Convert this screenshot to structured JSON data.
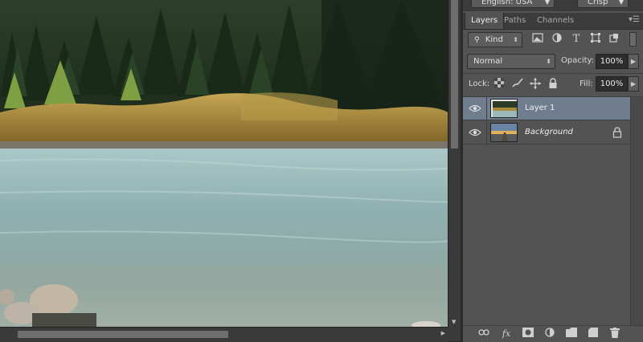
{
  "top": {
    "language_label": "English: USA",
    "sharpness_label": "Crisp"
  },
  "panel": {
    "tabs": [
      {
        "label": "Layers",
        "active": true
      },
      {
        "label": "Paths",
        "active": false
      },
      {
        "label": "Channels",
        "active": false
      }
    ],
    "menu_icon": "panel-menu-icon",
    "filter": {
      "kind_label": "Kind",
      "filter_icons": [
        "image-filter-icon",
        "adjustment-filter-icon",
        "type-filter-icon",
        "shape-filter-icon",
        "smart-object-filter-icon"
      ],
      "type_glyph": "T"
    },
    "blend_mode": "Normal",
    "opacity_label": "Opacity:",
    "opacity_value": "100%",
    "lock_label": "Lock:",
    "fill_label": "Fill:",
    "fill_value": "100%",
    "lock_icons": [
      "lock-transparent-icon",
      "lock-image-icon",
      "lock-position-icon",
      "lock-all-icon"
    ],
    "layers": [
      {
        "name": "Layer 1",
        "selected": true,
        "visible": true,
        "locked": false
      },
      {
        "name": "Background",
        "selected": false,
        "visible": true,
        "locked": true
      }
    ],
    "bottom_icons": [
      "link-layers-icon",
      "fx-icon",
      "add-mask-icon",
      "adjustment-layer-icon",
      "new-group-icon",
      "new-layer-icon",
      "delete-layer-icon"
    ],
    "fx_glyph": "fx"
  },
  "colors": {
    "panel_bg": "#535353",
    "selected_layer": "#6f7d8f",
    "scrollbar": "#3a3a3a",
    "water": "#93b5b6",
    "forest": "#223522",
    "shrubs": "#a8882e"
  }
}
